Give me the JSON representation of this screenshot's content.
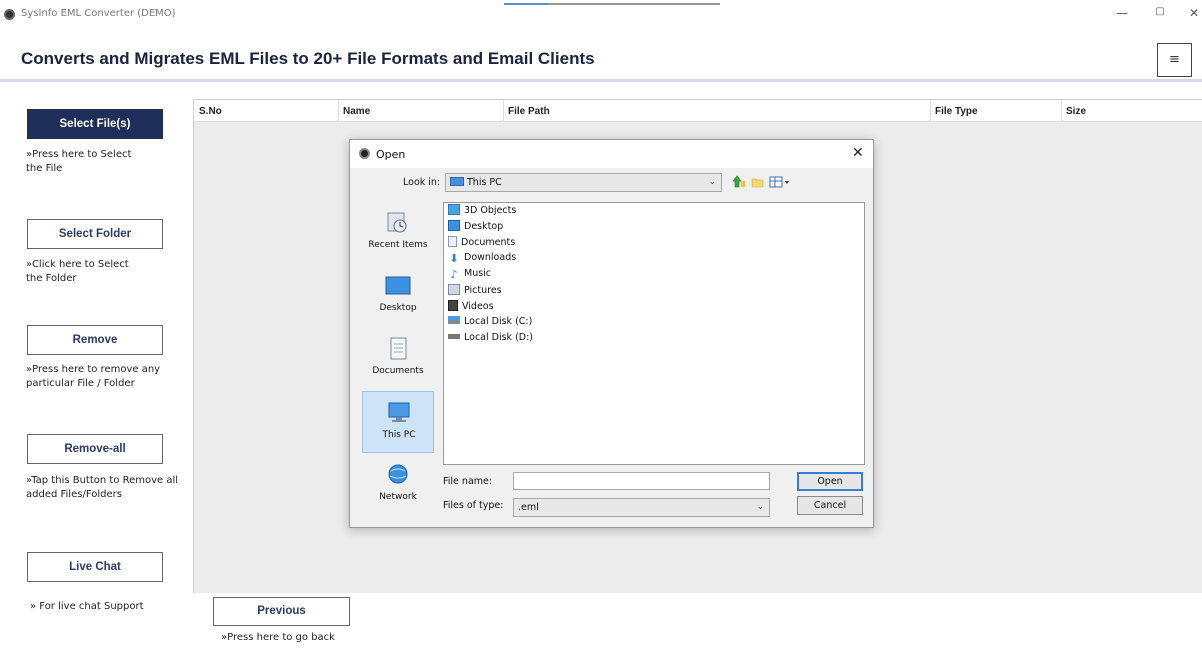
{
  "window": {
    "title": "SysInfo EML Converter (DEMO)",
    "minimize": "—",
    "maximize": "▢",
    "close": "✕"
  },
  "header": {
    "title": "Converts and Migrates EML Files to 20+ File Formats and Email Clients",
    "menu_icon": "≡"
  },
  "sidebar": {
    "select_files": {
      "label": "Select File(s)",
      "hint": "»Press here to Select the File"
    },
    "select_folder": {
      "label": "Select Folder",
      "hint": "»Click here to Select the Folder"
    },
    "remove": {
      "label": "Remove",
      "hint": "»Press here to remove any particular File / Folder"
    },
    "remove_all": {
      "label": "Remove-all",
      "hint": "»Tap this Button to Remove all added Files/Folders"
    },
    "live_chat": {
      "label": "Live Chat",
      "hint": "» For live chat Support"
    }
  },
  "table": {
    "columns": [
      "S.No",
      "Name",
      "File Path",
      "File Type",
      "Size"
    ],
    "rows": []
  },
  "footer": {
    "previous_label": "Previous",
    "previous_hint": "»Press here to go back"
  },
  "dialog": {
    "title": "Open",
    "close": "✕",
    "look_in_label": "Look in:",
    "look_in_value": "This PC",
    "places": [
      "Recent Items",
      "Desktop",
      "Documents",
      "This PC",
      "Network"
    ],
    "selected_place": "This PC",
    "items": [
      "3D Objects",
      "Desktop",
      "Documents",
      "Downloads",
      "Music",
      "Pictures",
      "Videos",
      "Local Disk (C:)",
      "Local Disk (D:)"
    ],
    "file_name_label": "File name:",
    "file_name_value": "",
    "files_of_type_label": "Files of type:",
    "files_of_type_value": ".eml",
    "open_label": "Open",
    "cancel_label": "Cancel"
  },
  "colors": {
    "primary_button": "#1f2f5a",
    "header_title": "#1c2340",
    "header_border": "#d9d4ef",
    "dialog_selection": "#cfe3f7"
  }
}
